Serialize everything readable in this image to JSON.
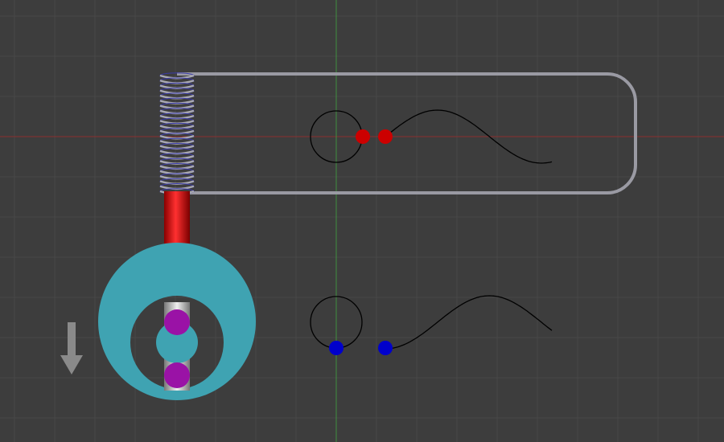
{
  "scene": {
    "colors": {
      "background": "#3d3d3d",
      "grid_line": "#484848",
      "x_axis": "#8a3030",
      "y_axis": "#3f8f3f",
      "frame_rod": "#9a9aa3",
      "spring_coil": "#a9a9b2",
      "spring_inner": "#3a3aa8",
      "piston_rod": "#c81010",
      "eccentric_disc": "#3fa3b2",
      "guide_rod": "#b9b9b9",
      "pin": "#9a12a6",
      "upper_marker": "#cc0000",
      "lower_marker": "#0000cc",
      "curve": "#000000",
      "arrow": "#8a8a8a"
    },
    "icons": {
      "direction_arrow": "down-arrow-icon"
    },
    "mechanism": {
      "parts": [
        "frame",
        "spring",
        "piston",
        "eccentric-disc",
        "guide-rod",
        "pins"
      ],
      "pin_count": 2
    },
    "upper_trace": {
      "marker_count": 2,
      "curve_shape": "sine"
    },
    "lower_trace": {
      "marker_count": 2,
      "curve_shape": "sine"
    }
  }
}
